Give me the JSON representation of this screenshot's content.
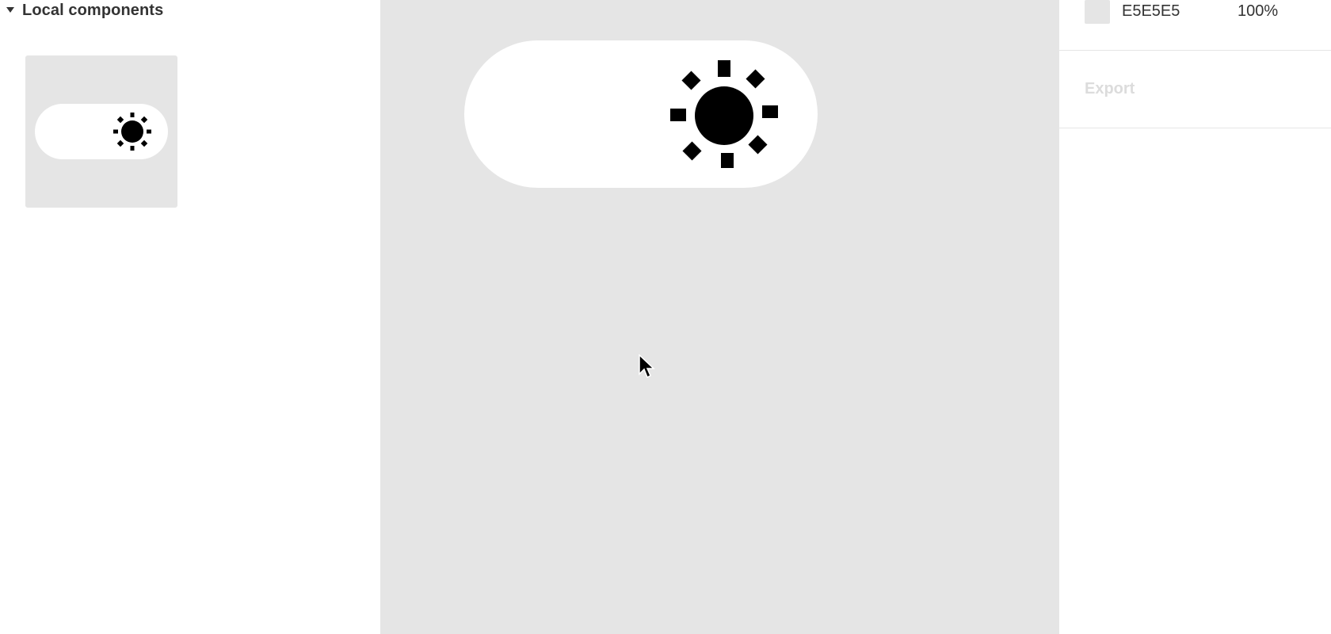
{
  "assets_panel": {
    "section_title": "Local components",
    "component_icon": "theme-toggle-icon"
  },
  "canvas": {
    "background": "#E5E5E5",
    "component_icons": [
      "moon-icon",
      "sun-icon"
    ]
  },
  "design_panel": {
    "fill": {
      "hex": "E5E5E5",
      "opacity": "100%",
      "swatch_color": "#E5E5E5"
    },
    "export": {
      "title": "Export"
    }
  }
}
